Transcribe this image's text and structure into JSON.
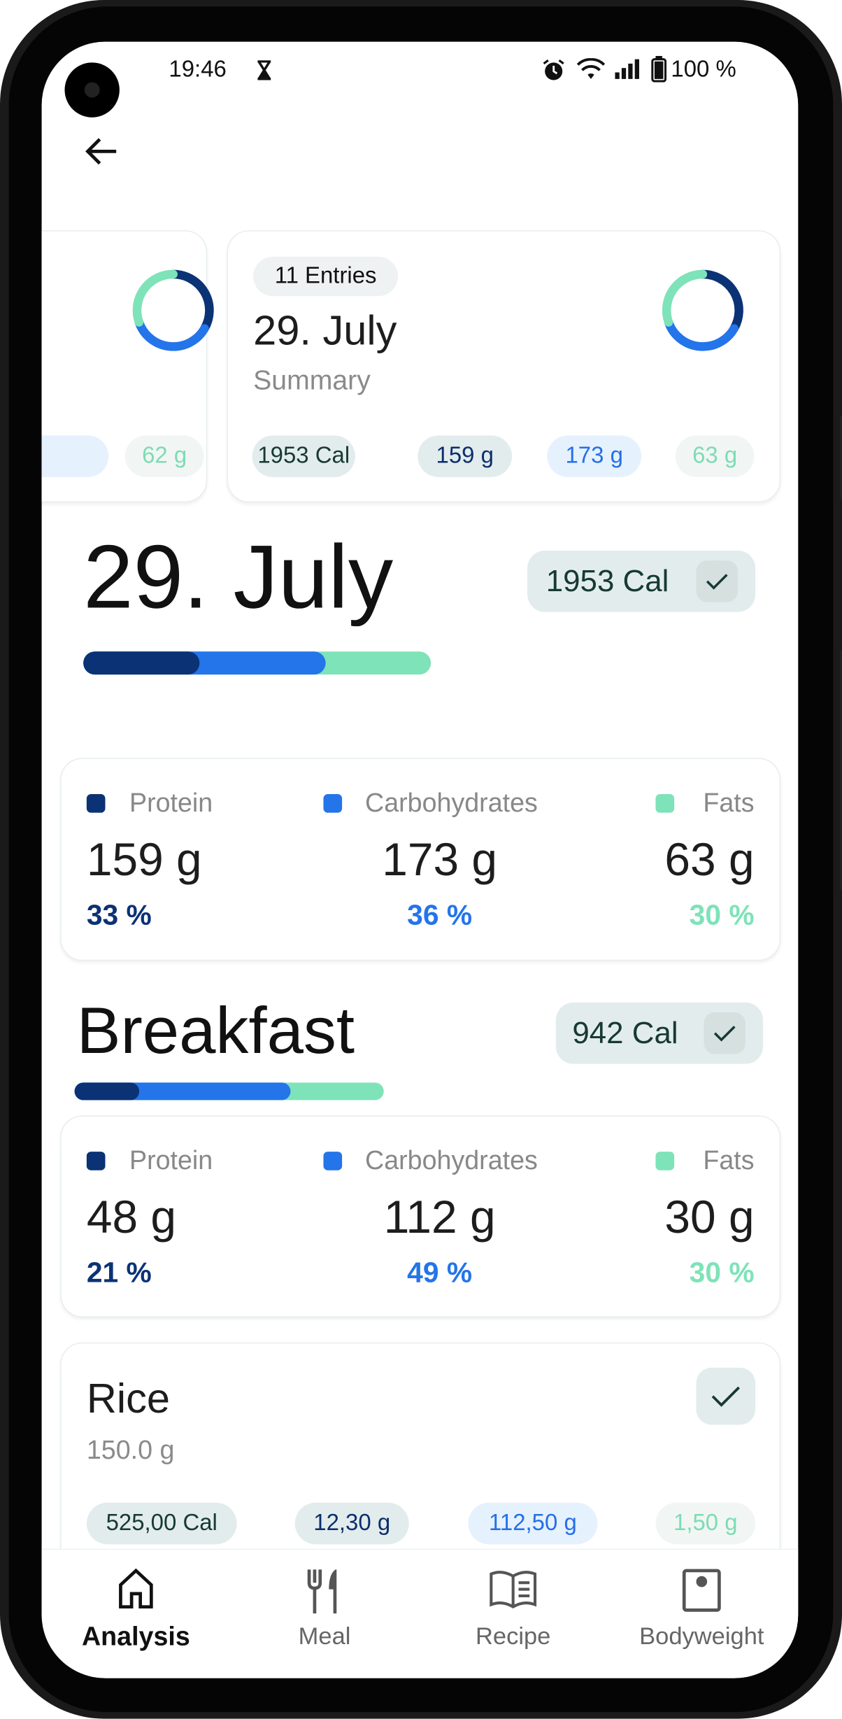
{
  "status_bar": {
    "time": "19:46",
    "battery": "100 %",
    "icons": [
      "hourglass-icon",
      "alarm-icon",
      "wifi-icon",
      "signal-icon",
      "battery-icon"
    ]
  },
  "colors": {
    "protein": "#0b3275",
    "carbohydrates": "#2474ea",
    "fats": "#7ee3b8",
    "calories": "#163a33"
  },
  "day_cards": [
    {
      "fats": "62 g",
      "partial": true,
      "macro_split": {
        "protein": 33,
        "carbohydrates": 36,
        "fats": 30
      }
    },
    {
      "entries": "11 Entries",
      "date": "29. July",
      "subtitle": "Summary",
      "calories": "1953 Cal",
      "protein": "159 g",
      "carbohydrates": "173 g",
      "fats": "63 g",
      "macro_split": {
        "protein": 33,
        "carbohydrates": 36,
        "fats": 30
      }
    }
  ],
  "day": {
    "title": "29. July",
    "calories": "1953 Cal",
    "checked": true,
    "progress": {
      "protein": 33,
      "carbohydrates": 36,
      "fats": 30
    },
    "macros": {
      "protein_label": "Protein",
      "carbs_label": "Carbohydrates",
      "fats_label": "Fats",
      "protein": "159 g",
      "carbs": "173 g",
      "fats": "63 g",
      "protein_pct": "33 %",
      "carbs_pct": "36 %",
      "fats_pct": "30 %"
    }
  },
  "meal": {
    "title": "Breakfast",
    "calories": "942 Cal",
    "checked": true,
    "progress": {
      "protein": 21,
      "carbohydrates": 49,
      "fats": 30
    },
    "macros": {
      "protein_label": "Protein",
      "carbs_label": "Carbohydrates",
      "fats_label": "Fats",
      "protein": "48 g",
      "carbs": "112 g",
      "fats": "30 g",
      "protein_pct": "21 %",
      "carbs_pct": "49 %",
      "fats_pct": "30 %"
    }
  },
  "entry": {
    "name": "Rice",
    "amount": "150.0 g",
    "checked": true,
    "calories": "525,00 Cal",
    "protein": "12,30 g",
    "carbohydrates": "112,50 g",
    "fats": "1,50 g"
  },
  "nav": [
    {
      "label": "Analysis",
      "icon": "home-icon",
      "active": true
    },
    {
      "label": "Meal",
      "icon": "fork-knife-icon",
      "active": false
    },
    {
      "label": "Recipe",
      "icon": "book-icon",
      "active": false
    },
    {
      "label": "Bodyweight",
      "icon": "scale-icon",
      "active": false
    }
  ]
}
